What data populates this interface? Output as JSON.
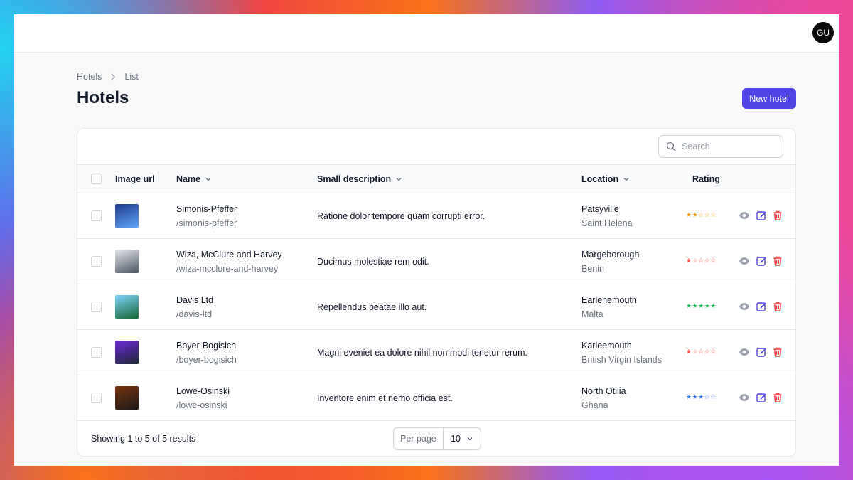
{
  "user": {
    "initials": "GU"
  },
  "breadcrumb": [
    "Hotels",
    "List"
  ],
  "page": {
    "title": "Hotels",
    "new_button": "New hotel"
  },
  "search": {
    "placeholder": "Search"
  },
  "columns": {
    "image": "Image url",
    "name": "Name",
    "description": "Small description",
    "location": "Location",
    "rating": "Rating"
  },
  "rows": [
    {
      "name": "Simonis-Pfeffer",
      "slug": "/simonis-pfeffer",
      "description": "Ratione dolor tempore quam corrupti error.",
      "city": "Patsyville",
      "country": "Saint Helena",
      "rating": 2,
      "star_color": "#f59e0b",
      "thumb": [
        "#1e3a8a",
        "#60a5fa"
      ]
    },
    {
      "name": "Wiza, McClure and Harvey",
      "slug": "/wiza-mcclure-and-harvey",
      "description": "Ducimus molestiae rem odit.",
      "city": "Margeborough",
      "country": "Benin",
      "rating": 1,
      "star_color": "#ef4444",
      "thumb": [
        "#e5e7eb",
        "#4b5563"
      ]
    },
    {
      "name": "Davis Ltd",
      "slug": "/davis-ltd",
      "description": "Repellendus beatae illo aut.",
      "city": "Earlenemouth",
      "country": "Malta",
      "rating": 5,
      "star_color": "#22c55e",
      "thumb": [
        "#7dd3fc",
        "#166534"
      ]
    },
    {
      "name": "Boyer-Bogisich",
      "slug": "/boyer-bogisich",
      "description": "Magni eveniet ea dolore nihil non modi tenetur rerum.",
      "city": "Karleemouth",
      "country": "British Virgin Islands",
      "rating": 1,
      "star_color": "#ef4444",
      "thumb": [
        "#6d28d9",
        "#1f2937"
      ]
    },
    {
      "name": "Lowe-Osinski",
      "slug": "/lowe-osinski",
      "description": "Inventore enim et nemo officia est.",
      "city": "North Otilia",
      "country": "Ghana",
      "rating": 3,
      "star_color": "#3b82f6",
      "thumb": [
        "#78350f",
        "#1c1917"
      ]
    }
  ],
  "icons": {
    "view": "eye-icon",
    "edit": "edit-icon",
    "delete": "trash-icon"
  },
  "footer": {
    "results_text": "Showing 1 to 5 of 5 results",
    "per_page_label": "Per page",
    "per_page_value": "10"
  },
  "colors": {
    "accent": "#4f46e5",
    "danger": "#ef4444",
    "view_icon": "#9ca3af"
  }
}
